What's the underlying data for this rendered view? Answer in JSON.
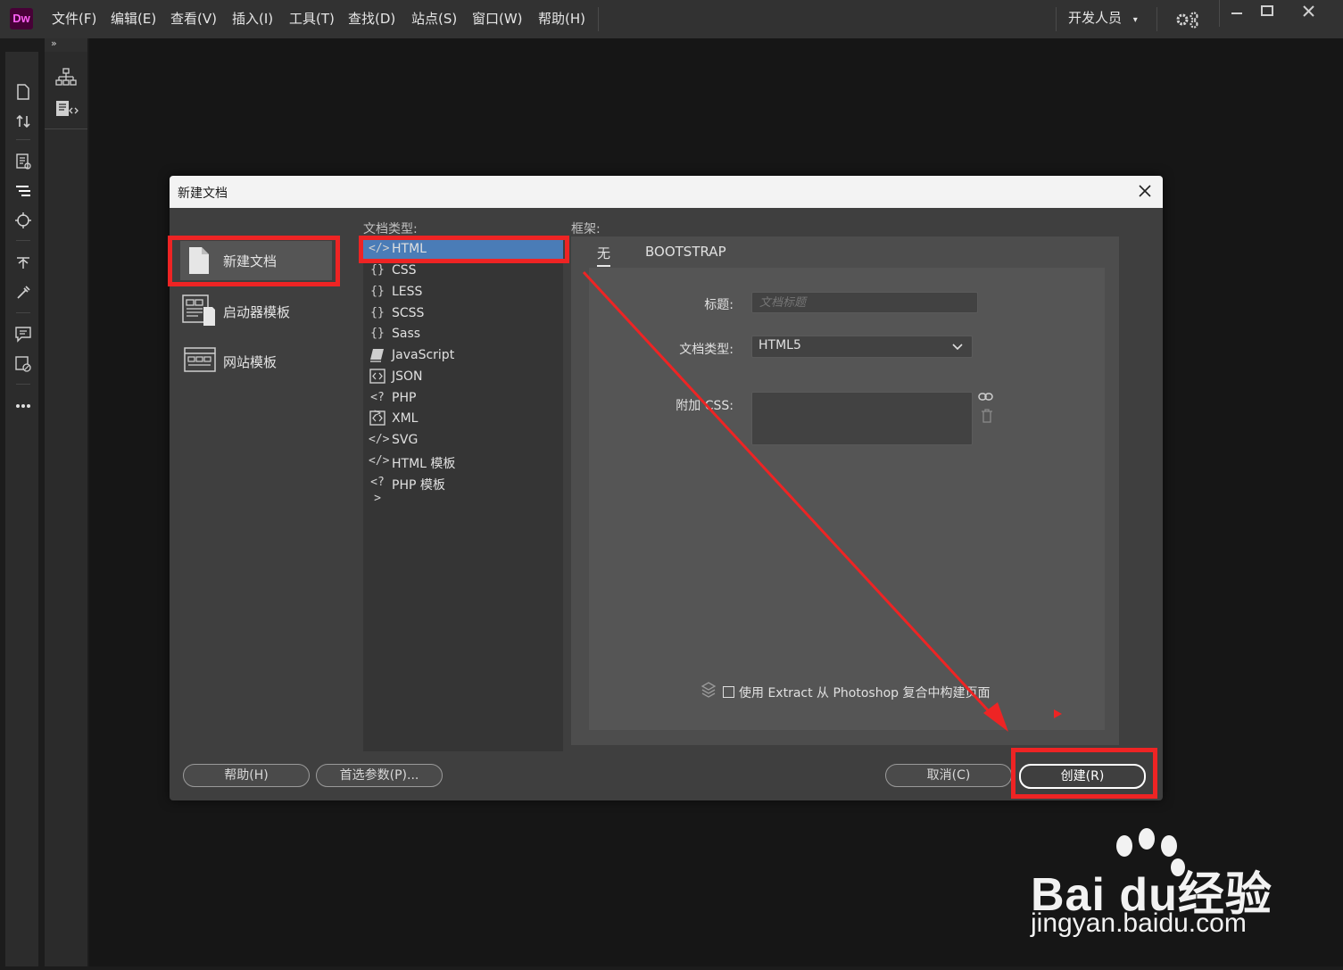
{
  "app": {
    "logo": "Dw",
    "menus": [
      "文件(F)",
      "编辑(E)",
      "查看(V)",
      "插入(I)",
      "工具(T)",
      "查找(D)",
      "站点(S)",
      "窗口(W)",
      "帮助(H)"
    ],
    "workspace": "开发人员"
  },
  "dialog": {
    "title": "新建文档",
    "categories": [
      {
        "label": "新建文档",
        "icon": "blank-document-icon",
        "selected": true
      },
      {
        "label": "启动器模板",
        "icon": "starter-template-icon",
        "selected": false
      },
      {
        "label": "网站模板",
        "icon": "site-template-icon",
        "selected": false
      }
    ],
    "doc_type_header": "文档类型:",
    "doc_types": [
      {
        "label": "HTML",
        "icon": "</>",
        "selected": true
      },
      {
        "label": "CSS",
        "icon": "{}",
        "selected": false
      },
      {
        "label": "LESS",
        "icon": "{}",
        "selected": false
      },
      {
        "label": "SCSS",
        "icon": "{}",
        "selected": false
      },
      {
        "label": "Sass",
        "icon": "{}",
        "selected": false
      },
      {
        "label": "JavaScript",
        "icon": "js-icon",
        "selected": false
      },
      {
        "label": "JSON",
        "icon": "json-icon",
        "selected": false
      },
      {
        "label": "PHP",
        "icon": "<?>",
        "selected": false
      },
      {
        "label": "XML",
        "icon": "xml-icon",
        "selected": false
      },
      {
        "label": "SVG",
        "icon": "</>",
        "selected": false
      },
      {
        "label": "HTML 模板",
        "icon": "</>",
        "selected": false
      },
      {
        "label": "PHP 模板",
        "icon": "<?>",
        "selected": false
      }
    ],
    "framework_header": "框架:",
    "framework_tabs": [
      {
        "label": "无",
        "active": true
      },
      {
        "label": "BOOTSTRAP",
        "active": false
      }
    ],
    "form": {
      "title_label": "标题:",
      "title_placeholder": "文档标题",
      "doctype_label": "文档类型:",
      "doctype_value": "HTML5",
      "css_label": "附加 CSS:"
    },
    "extract_label": "使用 Extract 从 Photoshop 复合中构建页面",
    "buttons": {
      "help": "帮助(H)",
      "prefs": "首选参数(P)...",
      "cancel": "取消(C)",
      "create": "创建(R)"
    }
  },
  "watermark": {
    "brand": "Bai du经验",
    "url": "jingyan.baidu.com"
  },
  "colors": {
    "annotation_red": "#ee2424",
    "selected_blue": "#4a7cb7",
    "logo_bg": "#470137",
    "logo_fg": "#ff61f6"
  }
}
